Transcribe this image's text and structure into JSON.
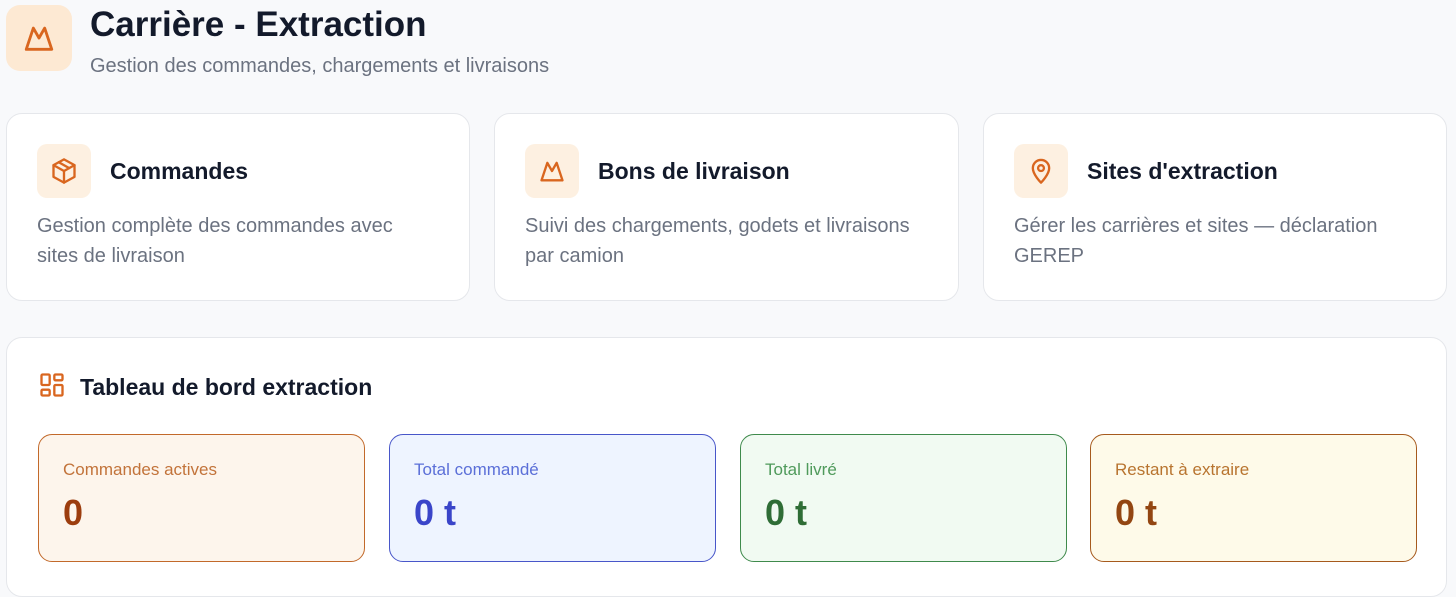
{
  "header": {
    "title": "Carrière - Extraction",
    "subtitle": "Gestion des commandes, chargements et livraisons",
    "icon": "mountain-icon"
  },
  "modules": [
    {
      "title": "Commandes",
      "description": "Gestion complète des commandes avec sites de livraison",
      "icon": "package-icon"
    },
    {
      "title": "Bons de livraison",
      "description": "Suivi des chargements, godets et livraisons par camion",
      "icon": "mountain-icon"
    },
    {
      "title": "Sites d'extraction",
      "description": "Gérer les carrières et sites — déclaration GEREP",
      "icon": "map-pin-icon"
    }
  ],
  "dashboard": {
    "title": "Tableau de bord extraction",
    "icon": "dashboard-icon",
    "stats": [
      {
        "label": "Commandes actives",
        "value": "0",
        "color": "#9c3d0e"
      },
      {
        "label": "Total commandé",
        "value": "0 t",
        "color": "#3a45c9"
      },
      {
        "label": "Total livré",
        "value": "0 t",
        "color": "#2f6d36"
      },
      {
        "label": "Restant à extraire",
        "value": "0 t",
        "color": "#934612"
      }
    ]
  },
  "colors": {
    "accent": "#d9661f",
    "icon_bg": "#fdf0e1",
    "page_bg": "#f8f9fb"
  }
}
